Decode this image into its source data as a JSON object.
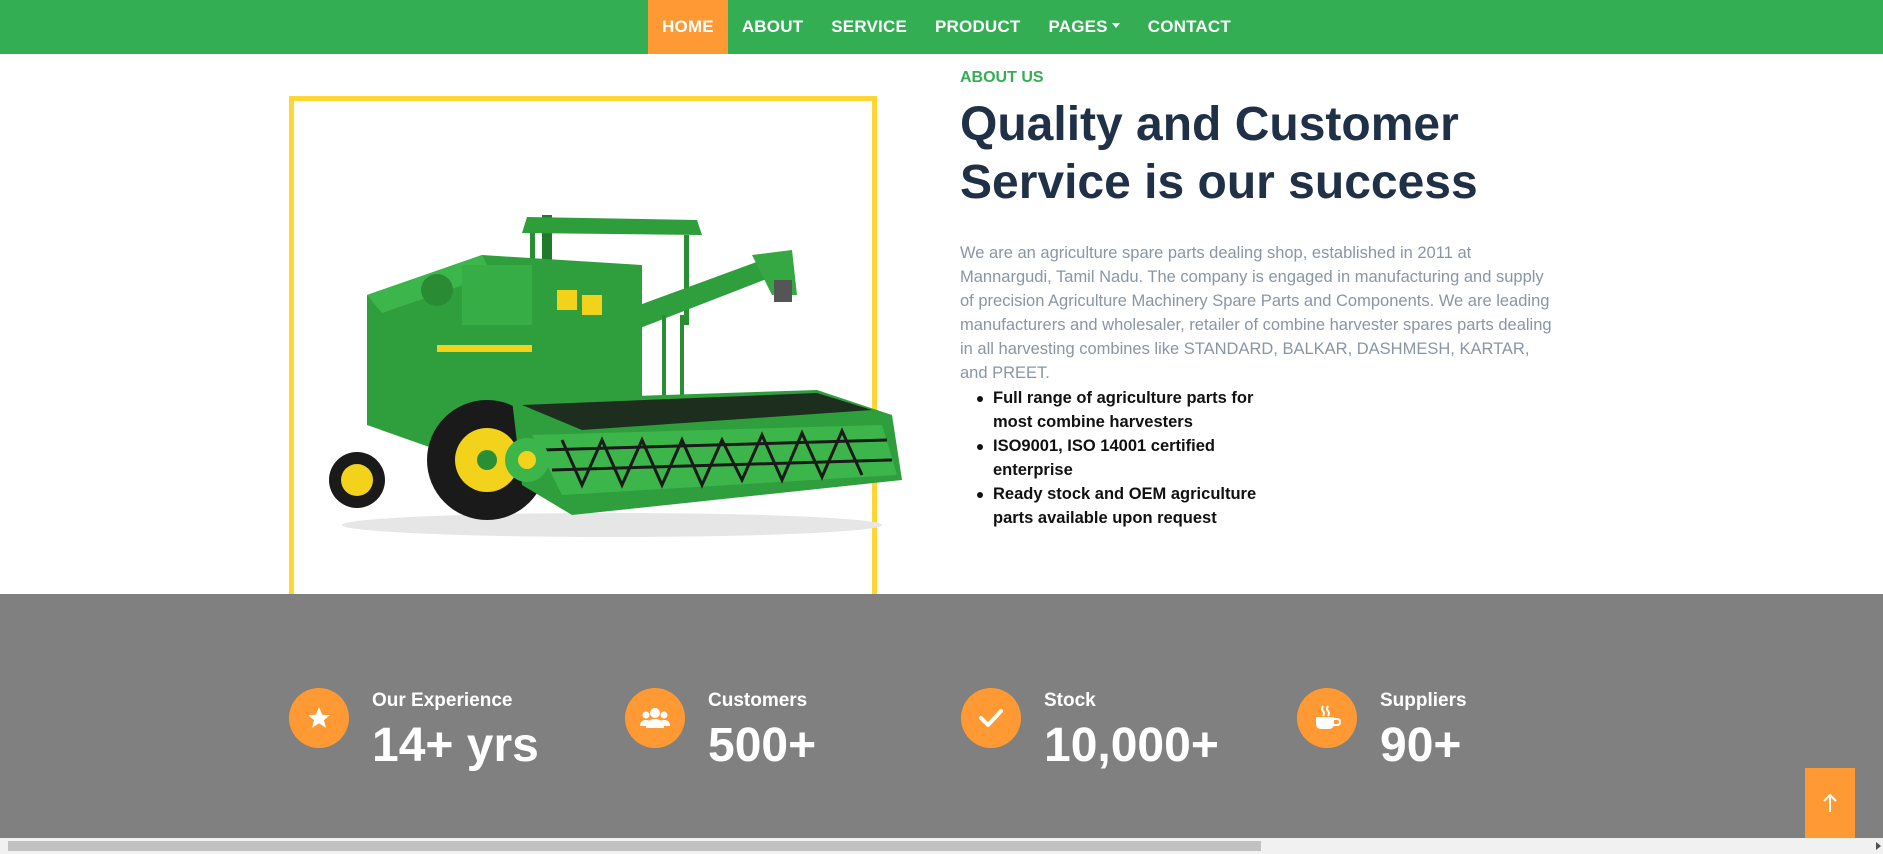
{
  "nav": {
    "items": [
      {
        "label": "HOME",
        "active": true
      },
      {
        "label": "ABOUT"
      },
      {
        "label": "SERVICE"
      },
      {
        "label": "PRODUCT"
      },
      {
        "label": "PAGES",
        "dropdown": true
      },
      {
        "label": "CONTACT"
      }
    ]
  },
  "about": {
    "label": "ABOUT US",
    "title": "Quality and Customer Service is our success",
    "text": "We are an agriculture spare parts dealing shop, established in 2011 at Mannargudi, Tamil Nadu. The company is engaged in manufacturing and supply of precision Agriculture Machinery Spare Parts and Components. We are leading manufacturers and wholesaler, retailer of combine harvester spares parts dealing in all harvesting combines like STANDARD, BALKAR, DASHMESH, KARTAR, and PREET.",
    "bullets": [
      "Full range of agriculture parts for most combine harvesters",
      "ISO9001, ISO 14001 certified enterprise",
      "Ready stock and OEM agriculture parts available upon request"
    ]
  },
  "stats": [
    {
      "label": "Our Experience",
      "value": "14+ yrs",
      "icon": "star-icon"
    },
    {
      "label": "Customers",
      "value": "500+",
      "icon": "users-icon"
    },
    {
      "label": "Stock",
      "value": "10,000+",
      "icon": "check-icon"
    },
    {
      "label": "Suppliers",
      "value": "90+",
      "icon": "coffee-icon"
    }
  ],
  "colors": {
    "nav_green": "#34ae52",
    "accent_orange": "#ff9933",
    "frame_yellow": "#ffd633",
    "title_navy": "#1f3047",
    "stats_gray": "#808080"
  }
}
